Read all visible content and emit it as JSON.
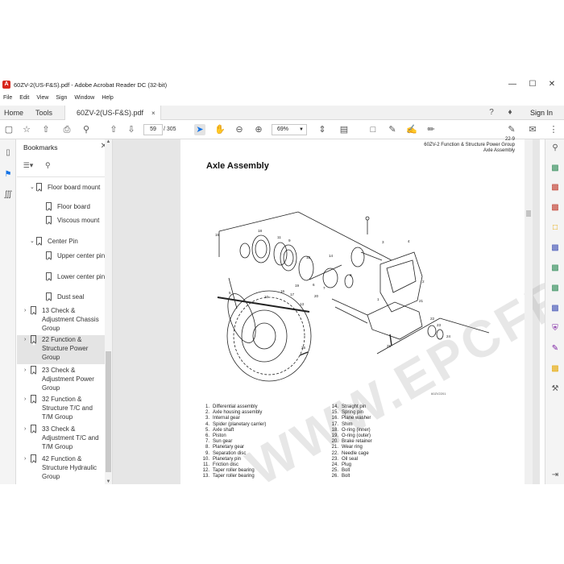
{
  "window": {
    "title": "60ZV-2(US-F&S).pdf - Adobe Acrobat Reader DC (32-bit)",
    "minimize": "—",
    "maximize": "☐",
    "close": "✕"
  },
  "menu": [
    "File",
    "Edit",
    "View",
    "Sign",
    "Window",
    "Help"
  ],
  "tabs": {
    "home": "Home",
    "tools": "Tools",
    "document": "60ZV-2(US-F&S).pdf",
    "close": "×",
    "sign_in": "Sign In"
  },
  "toolbar": {
    "page_current": "59",
    "page_total": "/ 305",
    "zoom": "69%"
  },
  "bookmarks": {
    "header": "Bookmarks",
    "items": [
      {
        "label": "Floor board mount",
        "level": 2,
        "toggle": "⌄"
      },
      {
        "label": "Floor board",
        "level": 3
      },
      {
        "label": "Viscous mount",
        "level": 3
      },
      {
        "label": "Center Pin",
        "level": 2,
        "toggle": "⌄"
      },
      {
        "label": "Upper center pin",
        "level": 3
      },
      {
        "label": "Lower center pin",
        "level": 3
      },
      {
        "label": "Dust seal",
        "level": 3
      },
      {
        "label": "13 Check & Adjustment Chassis Group",
        "level": 1,
        "toggle": "›"
      },
      {
        "label": "22 Function & Structure Power Group",
        "level": 1,
        "toggle": "›",
        "selected": true
      },
      {
        "label": "23 Check & Adjustment Power Group",
        "level": 1,
        "toggle": "›"
      },
      {
        "label": "32 Function & Structure T/C and T/M Group",
        "level": 1,
        "toggle": "›"
      },
      {
        "label": "33 Check & Adjustment T/C and T/M Group",
        "level": 1,
        "toggle": "›"
      },
      {
        "label": "42 Function & Structure Hydraulic Group",
        "level": 1,
        "toggle": "›"
      }
    ]
  },
  "document": {
    "running_head_1": "60ZV-2 Function & Structure Power Group",
    "running_head_2": "Axle Assembly",
    "running_head_0": "22-9",
    "title": "Axle Assembly",
    "figure_code": "60ZV2201",
    "watermark": "WWW.EPCFRO.COM",
    "parts_left": [
      {
        "n": "1.",
        "name": "Differential assembly"
      },
      {
        "n": "2.",
        "name": "Axle housing assembly"
      },
      {
        "n": "3.",
        "name": "Internal gear"
      },
      {
        "n": "4.",
        "name": "Spider (planetary carrier)"
      },
      {
        "n": "5.",
        "name": "Axle shaft"
      },
      {
        "n": "6.",
        "name": "Piston"
      },
      {
        "n": "7.",
        "name": "Sun gear"
      },
      {
        "n": "8.",
        "name": "Planetary gear"
      },
      {
        "n": "9.",
        "name": "Separation disc"
      },
      {
        "n": "10.",
        "name": "Planetary pin"
      },
      {
        "n": "11.",
        "name": "Friction disc"
      },
      {
        "n": "12.",
        "name": "Taper roller bearing"
      },
      {
        "n": "13.",
        "name": "Taper roller bearing"
      }
    ],
    "parts_right": [
      {
        "n": "14.",
        "name": "Straight pin"
      },
      {
        "n": "15.",
        "name": "Spring pin"
      },
      {
        "n": "16.",
        "name": "Plane washer"
      },
      {
        "n": "17.",
        "name": "Shim"
      },
      {
        "n": "18.",
        "name": "O-ring (inner)"
      },
      {
        "n": "19.",
        "name": "O-ring (outer)"
      },
      {
        "n": "20.",
        "name": "Brake retainer"
      },
      {
        "n": "21.",
        "name": "Wear ring"
      },
      {
        "n": "22.",
        "name": "Needle cage"
      },
      {
        "n": "23.",
        "name": "Oil seal"
      },
      {
        "n": "24.",
        "name": "Plug"
      },
      {
        "n": "25.",
        "name": "Bolt"
      },
      {
        "n": "26.",
        "name": "Bolt"
      }
    ],
    "callouts": [
      "15",
      "18",
      "11",
      "9",
      "12",
      "10",
      "16",
      "17",
      "19",
      "20",
      "13",
      "5",
      "26",
      "6",
      "7",
      "8",
      "14",
      "3",
      "4",
      "21",
      "22",
      "23",
      "24",
      "25",
      "1",
      "2"
    ]
  },
  "colors": {
    "accent": "#1473e6",
    "brand": "#d8261c"
  }
}
